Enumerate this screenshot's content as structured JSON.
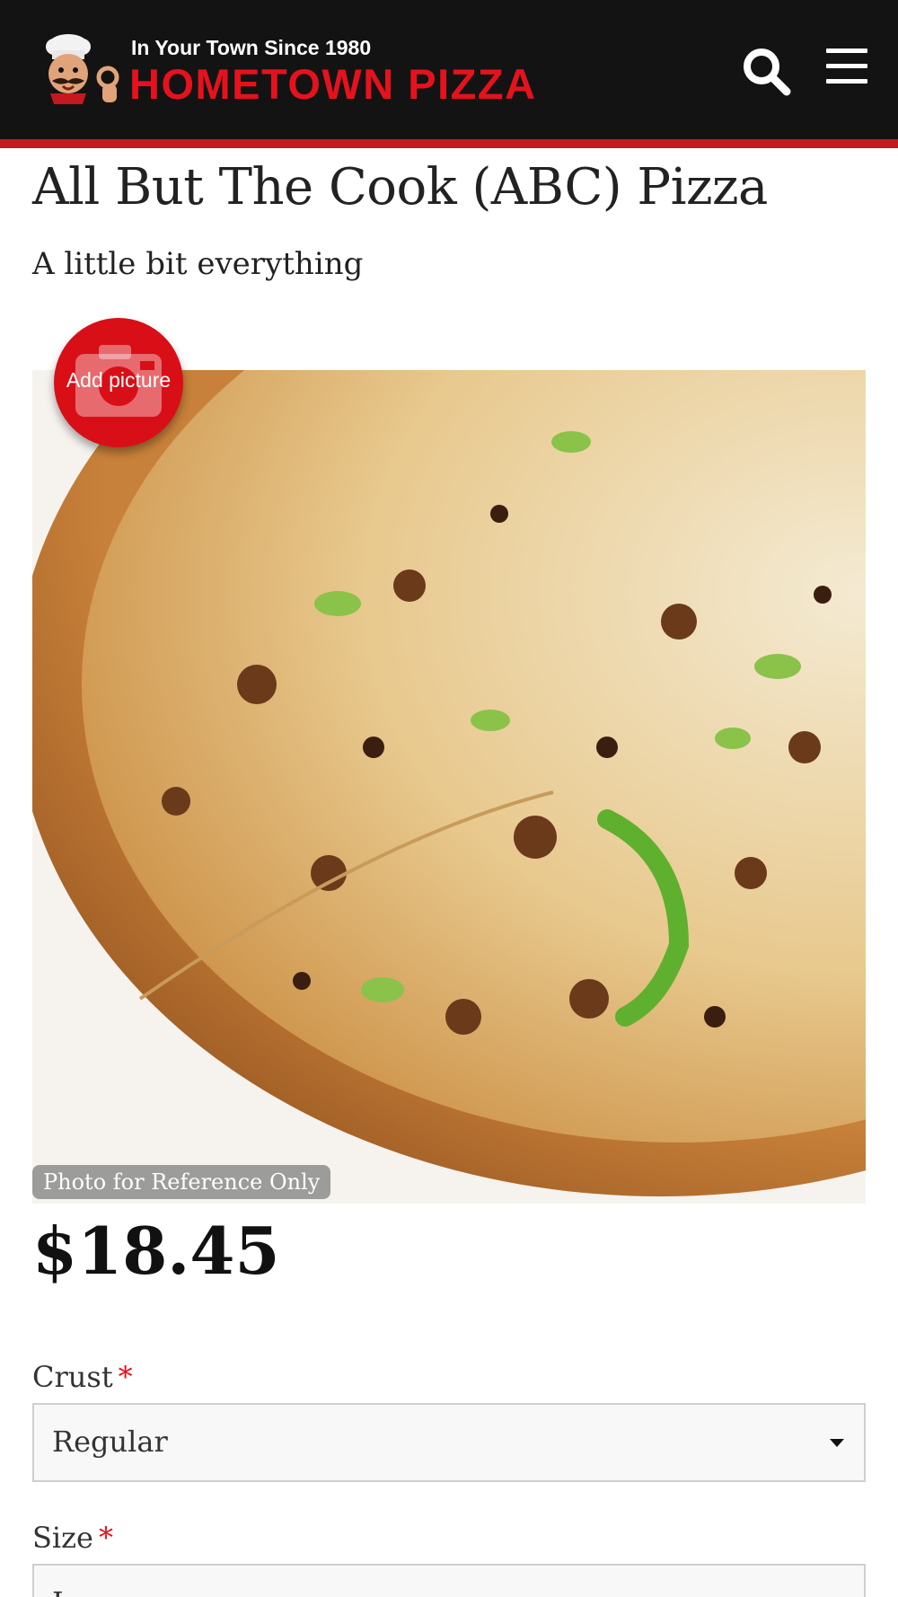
{
  "header": {
    "tagline": "In Your Town Since 1980",
    "brand_name": "HOMETOWN PIZZA",
    "logo_icon": "chef-mascot-icon",
    "search_icon": "search-icon",
    "menu_icon": "hamburger-menu-icon"
  },
  "colors": {
    "header_bg": "#131313",
    "accent_red": "#c4191f",
    "brand_red": "#e5121d"
  },
  "product": {
    "title": "All But The Cook (ABC) Pizza",
    "subtitle": "A little bit everything",
    "photo_note": "Photo for Reference Only",
    "add_picture_label": "Add picture",
    "add_picture_icon": "camera-icon",
    "price": "$18.45"
  },
  "options": {
    "crust": {
      "label": "Crust",
      "required_mark": "*",
      "selected": "Regular"
    },
    "size": {
      "label": "Size",
      "required_mark": "*",
      "selected": "L"
    }
  }
}
